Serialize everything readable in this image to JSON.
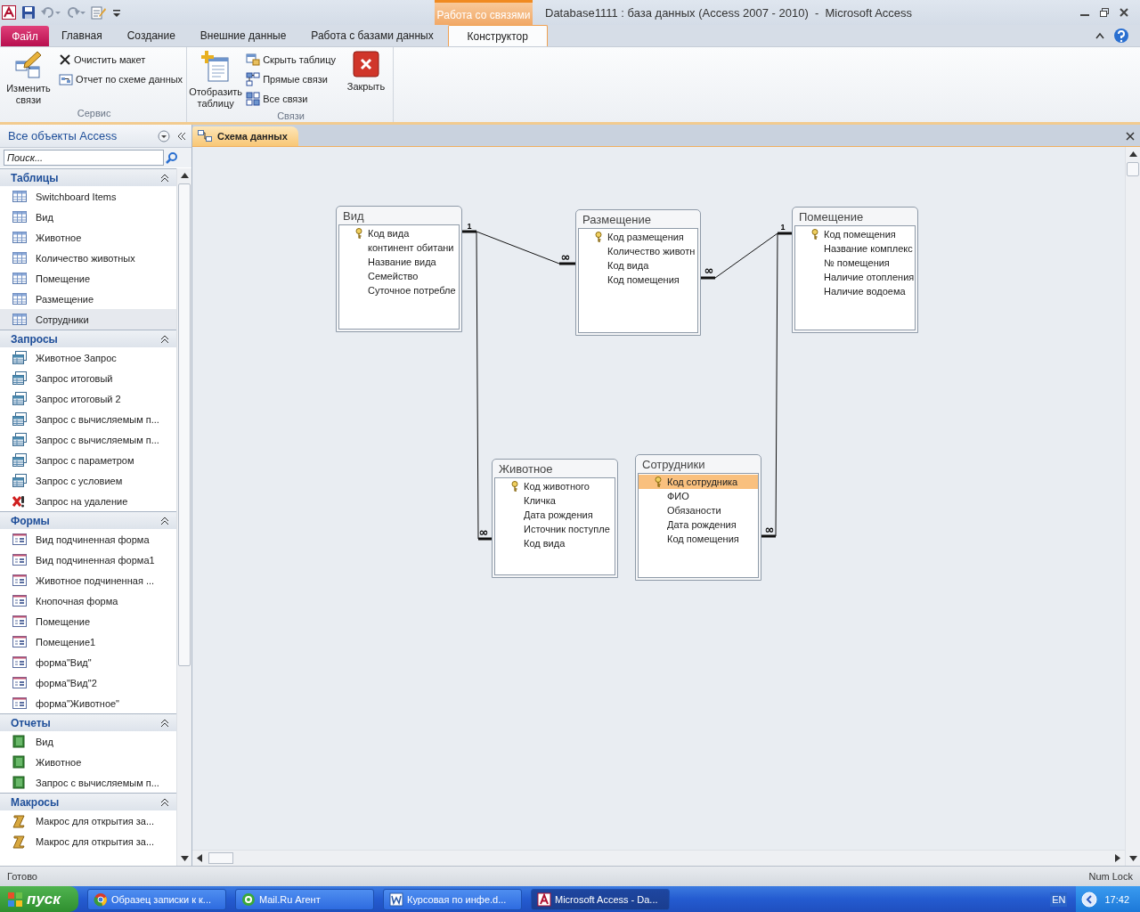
{
  "window": {
    "title": "Database1111 : база данных (Access 2007 - 2010)  -  Microsoft Access",
    "context_tab_group": "Работа со связями"
  },
  "ribbon_tabs": [
    {
      "label": "Файл",
      "kind": "file",
      "selected": false
    },
    {
      "label": "Главная",
      "kind": "normal",
      "selected": false
    },
    {
      "label": "Создание",
      "kind": "normal",
      "selected": false
    },
    {
      "label": "Внешние данные",
      "kind": "normal",
      "selected": false
    },
    {
      "label": "Работа с базами данных",
      "kind": "normal",
      "selected": false
    },
    {
      "label": "Конструктор",
      "kind": "context",
      "selected": true
    }
  ],
  "ribbon_groups": [
    {
      "label": "Сервис",
      "controls": [
        {
          "kind": "large",
          "label": "Изменить связи"
        },
        {
          "kind": "small",
          "label": "Очистить макет"
        },
        {
          "kind": "small",
          "label": "Отчет по схеме данных"
        }
      ]
    },
    {
      "label": "Связи",
      "controls": [
        {
          "kind": "large",
          "label": "Отобразить таблицу"
        },
        {
          "kind": "small",
          "label": "Скрыть таблицу"
        },
        {
          "kind": "small",
          "label": "Прямые связи"
        },
        {
          "kind": "small",
          "label": "Все связи"
        },
        {
          "kind": "large",
          "label": "Закрыть"
        }
      ]
    }
  ],
  "nav_pane": {
    "title": "Все объекты Access",
    "search": {
      "placeholder": "Поиск..."
    },
    "groups": [
      {
        "title": "Таблицы",
        "expanded": true,
        "items": [
          {
            "label": "Switchboard Items",
            "kind": "table",
            "selected": false
          },
          {
            "label": "Вид",
            "kind": "table",
            "selected": false
          },
          {
            "label": "Животное",
            "kind": "table",
            "selected": false
          },
          {
            "label": "Количество животных",
            "kind": "table",
            "selected": false
          },
          {
            "label": "Помещение",
            "kind": "table",
            "selected": false
          },
          {
            "label": "Размещение",
            "kind": "table",
            "selected": false
          },
          {
            "label": "Сотрудники",
            "kind": "table",
            "selected": true
          }
        ]
      },
      {
        "title": "Запросы",
        "expanded": true,
        "items": [
          {
            "label": "Животное Запрос",
            "kind": "query",
            "selected": false
          },
          {
            "label": "Запрос итоговый",
            "kind": "query",
            "selected": false
          },
          {
            "label": "Запрос итоговый 2",
            "kind": "query",
            "selected": false
          },
          {
            "label": "Запрос с вычисляемым п...",
            "kind": "query",
            "selected": false
          },
          {
            "label": "Запрос с вычисляемым п...",
            "kind": "query",
            "selected": false
          },
          {
            "label": "Запрос с параметром",
            "kind": "query",
            "selected": false
          },
          {
            "label": "Запрос с условием",
            "kind": "query",
            "selected": false
          },
          {
            "label": "Запрос на удаление",
            "kind": "delete_query",
            "selected": false
          }
        ]
      },
      {
        "title": "Формы",
        "expanded": true,
        "items": [
          {
            "label": "Вид подчиненная форма",
            "kind": "form",
            "selected": false
          },
          {
            "label": "Вид подчиненная форма1",
            "kind": "form",
            "selected": false
          },
          {
            "label": "Животное подчиненная ...",
            "kind": "form",
            "selected": false
          },
          {
            "label": "Кнопочная форма",
            "kind": "form",
            "selected": false
          },
          {
            "label": "Помещение",
            "kind": "form",
            "selected": false
          },
          {
            "label": "Помещение1",
            "kind": "form",
            "selected": false
          },
          {
            "label": "форма\"Вид\"",
            "kind": "form",
            "selected": false
          },
          {
            "label": "форма\"Вид\"2",
            "kind": "form",
            "selected": false
          },
          {
            "label": "форма\"Животное\"",
            "kind": "form",
            "selected": false
          }
        ]
      },
      {
        "title": "Отчеты",
        "expanded": true,
        "items": [
          {
            "label": "Вид",
            "kind": "report",
            "selected": false
          },
          {
            "label": "Животное",
            "kind": "report",
            "selected": false
          },
          {
            "label": "Запрос с вычисляемым п...",
            "kind": "report",
            "selected": false
          }
        ]
      },
      {
        "title": "Макросы",
        "expanded": true,
        "items": [
          {
            "label": "Макрос для открытия за...",
            "kind": "macro",
            "selected": false
          },
          {
            "label": "Макрос для открытия за...",
            "kind": "macro",
            "selected": false
          }
        ]
      }
    ]
  },
  "document_tab": {
    "label": "Схема данных",
    "selected": true
  },
  "diagram": {
    "tables": [
      {
        "name": "Вид",
        "fields": [
          {
            "name": "Код вида",
            "key": true,
            "selected": false
          },
          {
            "name": "континент обитани",
            "key": false,
            "selected": false
          },
          {
            "name": "Название вида",
            "key": false,
            "selected": false
          },
          {
            "name": "Семейство",
            "key": false,
            "selected": false
          },
          {
            "name": "Суточное потребле",
            "key": false,
            "selected": false
          }
        ]
      },
      {
        "name": "Размещение",
        "fields": [
          {
            "name": "Код размещения",
            "key": true,
            "selected": false
          },
          {
            "name": "Количество животн",
            "key": false,
            "selected": false
          },
          {
            "name": "Код вида",
            "key": false,
            "selected": false
          },
          {
            "name": "Код помещения",
            "key": false,
            "selected": false
          }
        ]
      },
      {
        "name": "Помещение",
        "fields": [
          {
            "name": "Код помещения",
            "key": true,
            "selected": false
          },
          {
            "name": "Название комплекс",
            "key": false,
            "selected": false
          },
          {
            "name": "№ помещения",
            "key": false,
            "selected": false
          },
          {
            "name": "Наличие отопления",
            "key": false,
            "selected": false
          },
          {
            "name": "Наличие водоема",
            "key": false,
            "selected": false
          }
        ]
      },
      {
        "name": "Животное",
        "fields": [
          {
            "name": "Код животного",
            "key": true,
            "selected": false
          },
          {
            "name": "Кличка",
            "key": false,
            "selected": false
          },
          {
            "name": "Дата рождения",
            "key": false,
            "selected": false
          },
          {
            "name": "Источник поступле",
            "key": false,
            "selected": false
          },
          {
            "name": "Код вида",
            "key": false,
            "selected": false
          }
        ]
      },
      {
        "name": "Сотрудники",
        "fields": [
          {
            "name": "Код сотрудника",
            "key": true,
            "selected": true
          },
          {
            "name": "ФИО",
            "key": false,
            "selected": false
          },
          {
            "name": "Обязаности",
            "key": false,
            "selected": false
          },
          {
            "name": "Дата рождения",
            "key": false,
            "selected": false
          },
          {
            "name": "Код помещения",
            "key": false,
            "selected": false
          }
        ]
      }
    ],
    "relationships": [
      {
        "one_label": "1",
        "many_label": "∞"
      },
      {
        "many_label": "∞"
      },
      {
        "one_label": "1",
        "many_label": "∞"
      },
      {
        "many_label": "∞"
      }
    ]
  },
  "status_bar": {
    "left": "Готово",
    "right": "Num Lock"
  },
  "taskbar": {
    "start": "пуск",
    "tasks": [
      {
        "label": "Образец записки к к...",
        "selected": false
      },
      {
        "label": "Mail.Ru Агент",
        "selected": false
      },
      {
        "label": "Курсовая по инфе.d...",
        "selected": false
      },
      {
        "label": "Microsoft Access - Da...",
        "selected": true
      }
    ],
    "language": "EN",
    "clock": "17:42"
  }
}
